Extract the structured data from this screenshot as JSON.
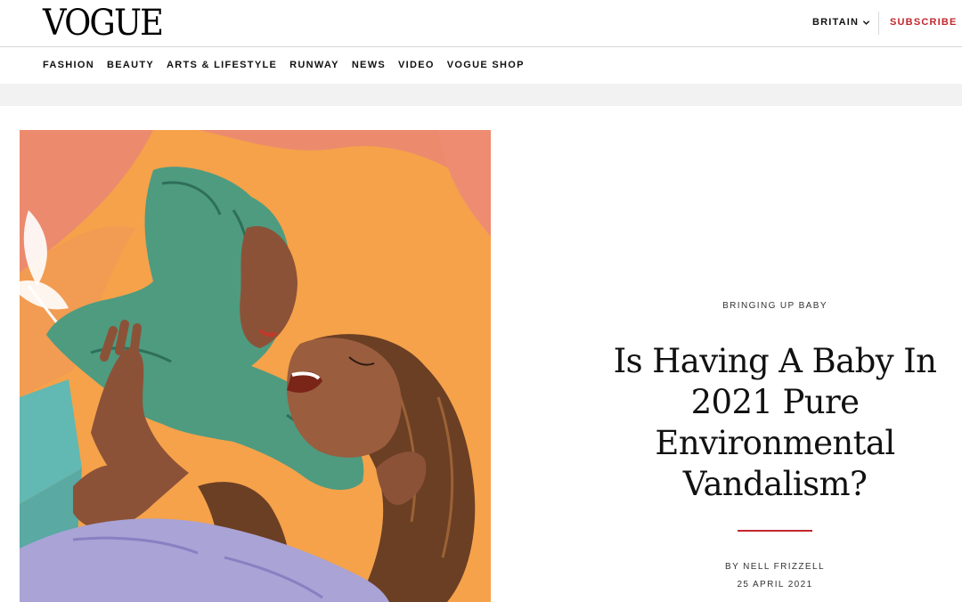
{
  "header": {
    "logo": "VOGUE",
    "region": "BRITAIN",
    "subscribe": "SUBSCRIBE"
  },
  "nav": {
    "items": [
      {
        "label": "FASHION"
      },
      {
        "label": "BEAUTY"
      },
      {
        "label": "ARTS & LIFESTYLE"
      },
      {
        "label": "RUNWAY"
      },
      {
        "label": "NEWS"
      },
      {
        "label": "VIDEO"
      },
      {
        "label": "VOGUE SHOP"
      }
    ]
  },
  "article": {
    "kicker": "BRINGING UP BABY",
    "headline": "Is Having A Baby In 2021 Pure Environmental Vandalism?",
    "byline": "BY NELL FRIZZELL",
    "date": "25 APRIL 2021"
  },
  "colors": {
    "accent": "#c2272d",
    "hero_orange": "#f5a24a",
    "hero_coral": "#ec8a6e",
    "hoodie_green": "#4e9b80",
    "shirt_lavender": "#a9a3d6"
  }
}
